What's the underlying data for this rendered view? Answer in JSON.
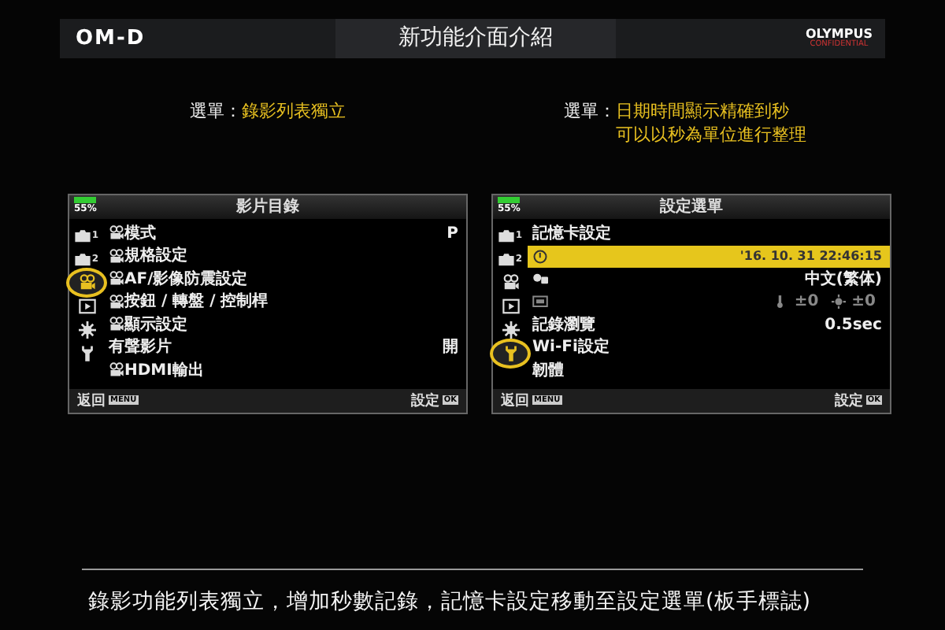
{
  "header": {
    "logo": "OM-D",
    "title": "新功能介面介紹",
    "brand": "OLYMPUS",
    "brand_note": "CONFIDENTIAL"
  },
  "notes": [
    {
      "label": "選單：",
      "lines": [
        "錄影列表獨立"
      ]
    },
    {
      "label": "選單：",
      "lines": [
        "日期時間顯示精確到秒",
        "可以以秒為單位進行整理"
      ]
    }
  ],
  "screens": [
    {
      "title": "影片目錄",
      "battery": "55%",
      "tabs": [
        {
          "kind": "camera",
          "label": "1",
          "selected": false
        },
        {
          "kind": "camera",
          "label": "2",
          "selected": false
        },
        {
          "kind": "movie",
          "selected": true
        },
        {
          "kind": "playback",
          "selected": false
        },
        {
          "kind": "gear",
          "selected": false
        },
        {
          "kind": "wrench",
          "selected": false
        }
      ],
      "items": [
        {
          "kind": "text",
          "movie_icon": true,
          "label": "模式",
          "value": "P",
          "selected": false
        },
        {
          "kind": "text",
          "movie_icon": true,
          "label": "規格設定",
          "selected": false
        },
        {
          "kind": "text",
          "movie_icon": true,
          "label": "AF/影像防震設定",
          "selected": false
        },
        {
          "kind": "text",
          "movie_icon": true,
          "label": "按鈕 / 轉盤 / 控制桿",
          "selected": false
        },
        {
          "kind": "text",
          "movie_icon": true,
          "label": "顯示設定",
          "selected": false
        },
        {
          "kind": "text",
          "movie_icon": false,
          "label": "有聲影片",
          "value": "開",
          "selected": false
        },
        {
          "kind": "text",
          "movie_icon": true,
          "label": "HDMI輸出",
          "selected": false
        }
      ],
      "footer": {
        "back": "返回",
        "back_key": "MENU",
        "confirm": "設定",
        "confirm_key": "OK"
      }
    },
    {
      "title": "設定選單",
      "battery": "55%",
      "tabs": [
        {
          "kind": "camera",
          "label": "1",
          "selected": false
        },
        {
          "kind": "camera",
          "label": "2",
          "selected": false
        },
        {
          "kind": "movie",
          "selected": false
        },
        {
          "kind": "playback",
          "selected": false
        },
        {
          "kind": "gear",
          "selected": false
        },
        {
          "kind": "wrench",
          "selected": true
        }
      ],
      "items": [
        {
          "kind": "text",
          "movie_icon": false,
          "label": "記憶卡設定",
          "selected": false
        },
        {
          "kind": "clock",
          "value": "'16. 10. 31  22:46:15",
          "selected": true
        },
        {
          "kind": "language",
          "value": "中文(繁体)",
          "selected": false
        },
        {
          "kind": "monitor",
          "values": [
            "±0",
            "±0"
          ],
          "selected": false
        },
        {
          "kind": "text",
          "movie_icon": false,
          "label": "記錄瀏覽",
          "value": "0.5sec",
          "selected": false
        },
        {
          "kind": "text",
          "movie_icon": false,
          "label": "Wi-Fi設定",
          "selected": false
        },
        {
          "kind": "text",
          "movie_icon": false,
          "label": "韌體",
          "selected": false
        }
      ],
      "footer": {
        "back": "返回",
        "back_key": "MENU",
        "confirm": "設定",
        "confirm_key": "OK"
      }
    }
  ],
  "caption": "錄影功能列表獨立，增加秒數記錄，記憶卡設定移動至設定選單(板手標誌)"
}
